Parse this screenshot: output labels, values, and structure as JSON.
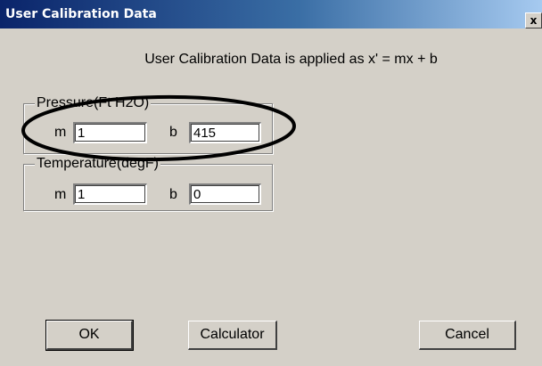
{
  "window": {
    "title": "User Calibration Data",
    "close_label": "x"
  },
  "instruction": "User Calibration Data is applied as x' = mx + b",
  "pressure": {
    "group_label": "Pressure(Ft H2O)",
    "m_label": "m",
    "m_value": "1",
    "b_label": "b",
    "b_value": "415"
  },
  "temperature": {
    "group_label": "Temperature(degF)",
    "m_label": "m",
    "m_value": "1",
    "b_label": "b",
    "b_value": "0"
  },
  "buttons": {
    "ok": "OK",
    "calculator": "Calculator",
    "cancel": "Cancel"
  },
  "colors": {
    "dialog_bg": "#d4d0c8",
    "titlebar_start": "#0a246a",
    "titlebar_end": "#a6caf0",
    "annotation": "#000000"
  }
}
